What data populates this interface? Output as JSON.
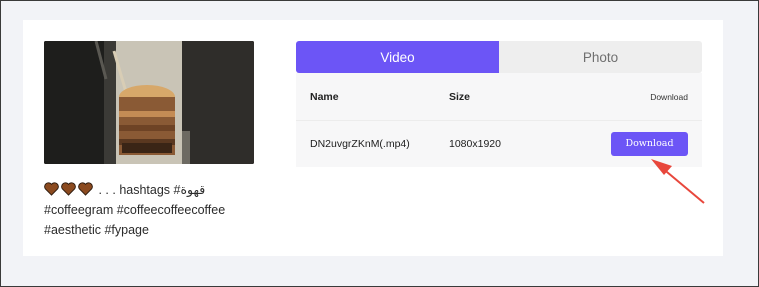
{
  "caption": {
    "line1": ". . . hashtags #قهوة",
    "line2": "#coffeegram #coffeecoffeecoffee",
    "line3": "#aesthetic #fypage",
    "heart_color": "#8b4a1f"
  },
  "tabs": [
    {
      "label": "Video"
    },
    {
      "label": "Photo"
    }
  ],
  "table": {
    "headers": {
      "name": "Name",
      "size": "Size",
      "download": "Download"
    },
    "rows": [
      {
        "name": "DN2uvgrZKnM(.mp4)",
        "size": "1080x1920",
        "button": "Download"
      }
    ]
  },
  "colors": {
    "accent": "#6c55f6",
    "arrow": "#e8473c"
  }
}
